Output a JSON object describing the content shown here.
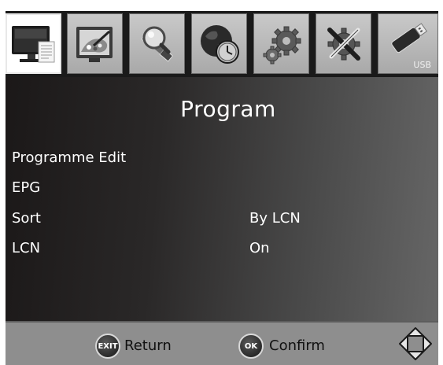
{
  "tabs": [
    {
      "name": "program",
      "icon": "tv-document-icon",
      "active": true
    },
    {
      "name": "picture",
      "icon": "picture-palette-icon",
      "active": false
    },
    {
      "name": "channel-search",
      "icon": "satellite-magnifier-icon",
      "active": false
    },
    {
      "name": "time",
      "icon": "globe-clock-icon",
      "active": false
    },
    {
      "name": "option",
      "icon": "gears-icon",
      "active": false
    },
    {
      "name": "system",
      "icon": "tools-icon",
      "active": false
    },
    {
      "name": "usb",
      "icon": "usb-drive-icon",
      "active": false,
      "label": "USB"
    }
  ],
  "page": {
    "title": "Program"
  },
  "menu": [
    {
      "label": "Programme Edit",
      "value": ""
    },
    {
      "label": "EPG",
      "value": ""
    },
    {
      "label": "Sort",
      "value": "By LCN"
    },
    {
      "label": "LCN",
      "value": "On"
    }
  ],
  "footer": {
    "exit_badge": "EXIT",
    "exit_label": "Return",
    "ok_badge": "OK",
    "ok_label": "Confirm"
  },
  "colors": {
    "active_tab": "#ffffff",
    "inactive_tab": "#b8b8b8",
    "footer_bg": "#8e8e8e"
  }
}
